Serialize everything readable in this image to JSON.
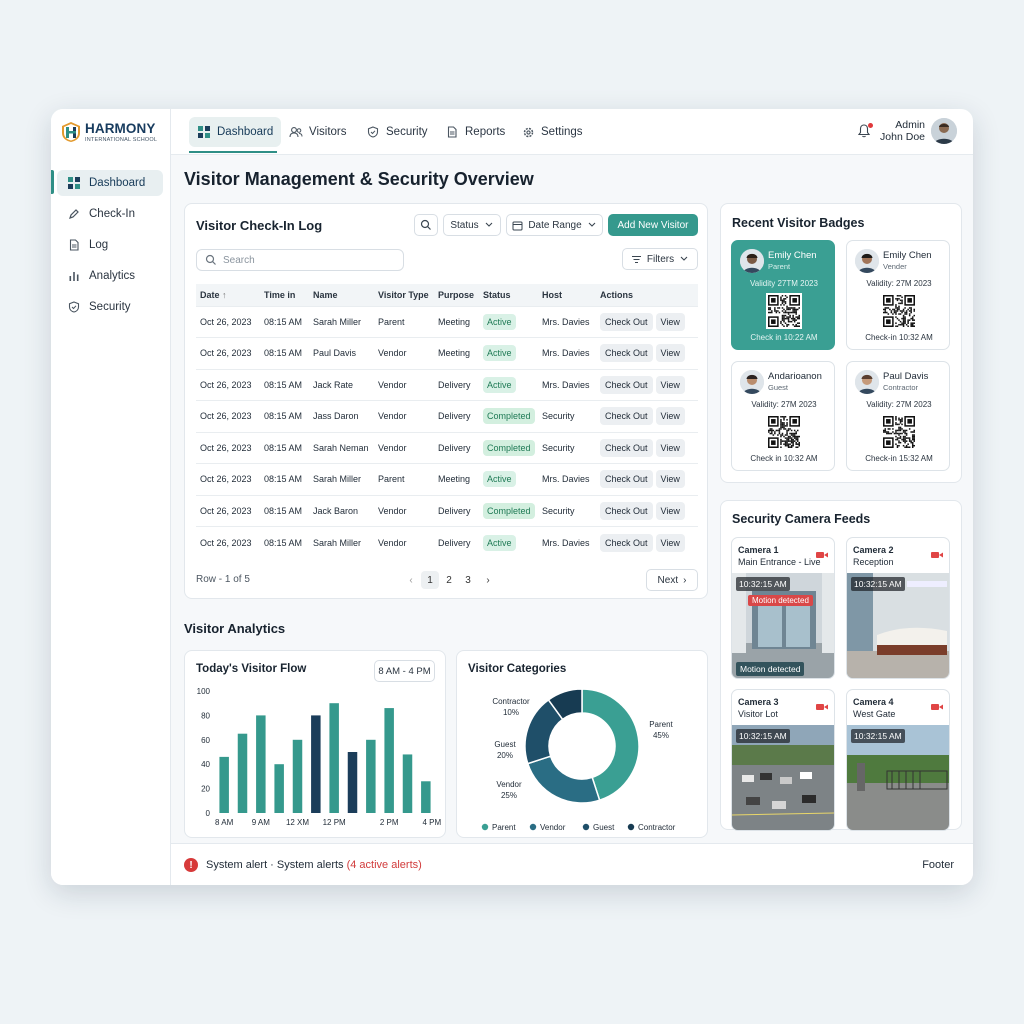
{
  "brand": {
    "name": "HARMONY",
    "tagline": "INTERNATIONAL SCHOOL"
  },
  "sidebar": {
    "items": [
      {
        "label": "Dashboard",
        "icon": "grid-icon",
        "active": true
      },
      {
        "label": "Check-In",
        "icon": "pen-icon"
      },
      {
        "label": "Log",
        "icon": "document-icon"
      },
      {
        "label": "Analytics",
        "icon": "bar-chart-icon"
      },
      {
        "label": "Security",
        "icon": "shield-icon"
      }
    ]
  },
  "topnav": {
    "items": [
      {
        "label": "Dashboard",
        "icon": "grid-icon",
        "active": true
      },
      {
        "label": "Visitors",
        "icon": "users-icon"
      },
      {
        "label": "Security",
        "icon": "shield-icon"
      },
      {
        "label": "Reports",
        "icon": "document-icon"
      },
      {
        "label": "Settings",
        "icon": "gear-icon"
      }
    ]
  },
  "user": {
    "role": "Admin",
    "name": "John Doe"
  },
  "page": {
    "title": "Visitor Management & Security Overview"
  },
  "log": {
    "title": "Visitor Check-In Log",
    "status_filter": "Status",
    "date_range": "Date Range",
    "add_button": "Add New Visitor",
    "search_placeholder": "Search",
    "filters_label": "Filters",
    "columns": [
      "Date",
      "Time in",
      "Name",
      "Visitor Type",
      "Purpose",
      "Status",
      "Host",
      "Actions"
    ],
    "rows": [
      {
        "date": "Oct 26, 2023",
        "time": "08:15 AM",
        "name": "Sarah Miller",
        "type": "Parent",
        "purpose": "Meeting",
        "status": "Active",
        "host": "Mrs. Davies"
      },
      {
        "date": "Oct 26, 2023",
        "time": "08:15 AM",
        "name": "Paul Davis",
        "type": "Vendor",
        "purpose": "Meeting",
        "status": "Active",
        "host": "Mrs. Davies"
      },
      {
        "date": "Oct 26, 2023",
        "time": "08:15 AM",
        "name": "Jack Rate",
        "type": "Vendor",
        "purpose": "Delivery",
        "status": "Active",
        "host": "Mrs. Davies"
      },
      {
        "date": "Oct 26, 2023",
        "time": "08:15 AM",
        "name": "Jass Daron",
        "type": "Vendor",
        "purpose": "Delivery",
        "status": "Completed",
        "host": "Security"
      },
      {
        "date": "Oct 26, 2023",
        "time": "08:15 AM",
        "name": "Sarah Neman",
        "type": "Vendor",
        "purpose": "Delivery",
        "status": "Completed",
        "host": "Security"
      },
      {
        "date": "Oct 26, 2023",
        "time": "08:15 AM",
        "name": "Sarah Miller",
        "type": "Parent",
        "purpose": "Meeting",
        "status": "Active",
        "host": "Mrs. Davies"
      },
      {
        "date": "Oct 26, 2023",
        "time": "08:15 AM",
        "name": "Jack Baron",
        "type": "Vendor",
        "purpose": "Delivery",
        "status": "Completed",
        "host": "Security"
      },
      {
        "date": "Oct 26, 2023",
        "time": "08:15 AM",
        "name": "Sarah Miller",
        "type": "Vendor",
        "purpose": "Delivery",
        "status": "Active",
        "host": "Mrs. Davies"
      }
    ],
    "actions": {
      "checkout": "Check Out",
      "view": "View"
    },
    "pagination": {
      "summary": "Row - 1 of 5",
      "pages": [
        "1",
        "2",
        "3"
      ],
      "current": "1",
      "next": "Next"
    }
  },
  "badges": {
    "title": "Recent Visitor Badges",
    "items": [
      {
        "name": "Emily Chen",
        "role": "Parent",
        "validity": "Validity 27TM 2023",
        "checkin": "Check in 10:22 AM",
        "highlight": true
      },
      {
        "name": "Emily Chen",
        "role": "Vender",
        "validity": "Validity: 27M 2023",
        "checkin": "Check-in 10:32 AM",
        "highlight": false
      },
      {
        "name": "Andarioanon",
        "role": "Guest",
        "validity": "Validity: 27M 2023",
        "checkin": "Check in 10:32 AM",
        "highlight": false
      },
      {
        "name": "Paul Davis",
        "role": "Contractor",
        "validity": "Validity: 27M 2023",
        "checkin": "Check-in 15:32 AM",
        "highlight": false
      }
    ]
  },
  "cameras": {
    "title": "Security Camera Feeds",
    "items": [
      {
        "name": "Camera 1",
        "location": "Main Entrance - Live",
        "time": "10:32:15 AM",
        "alert": "Motion detected",
        "status": "Motion detected"
      },
      {
        "name": "Camera 2",
        "location": "Reception",
        "time": "10:32:15 AM"
      },
      {
        "name": "Camera 3",
        "location": "Visitor Lot",
        "time": "10:32:15 AM"
      },
      {
        "name": "Camera 4",
        "location": "West Gate",
        "time": "10:32:15 AM"
      }
    ]
  },
  "analytics": {
    "title": "Visitor Analytics"
  },
  "colors": {
    "teal": "#35998d",
    "navy": "#1b3d5a",
    "alert": "#d73a3a"
  },
  "chart_data": [
    {
      "type": "bar",
      "title": "Today's Visitor Flow",
      "range_label": "8 AM - 4 PM",
      "ylim": [
        0,
        100
      ],
      "yticks": [
        0,
        20,
        40,
        60,
        80,
        100
      ],
      "xtick_labels": [
        "8 AM",
        "9 AM",
        "12 XM",
        "12 PM",
        "2 PM",
        "4 PM"
      ],
      "values": [
        46,
        65,
        80,
        40,
        60,
        80,
        90,
        50,
        60,
        86,
        48,
        26
      ],
      "highlight_indices": [
        5,
        7
      ],
      "grid": false
    },
    {
      "type": "pie",
      "title": "Visitor Categories",
      "labels": [
        "Parent",
        "Vendor",
        "Guest",
        "Contractor"
      ],
      "values": [
        45,
        25,
        20,
        10
      ],
      "legend": "bottom"
    }
  ]
}
